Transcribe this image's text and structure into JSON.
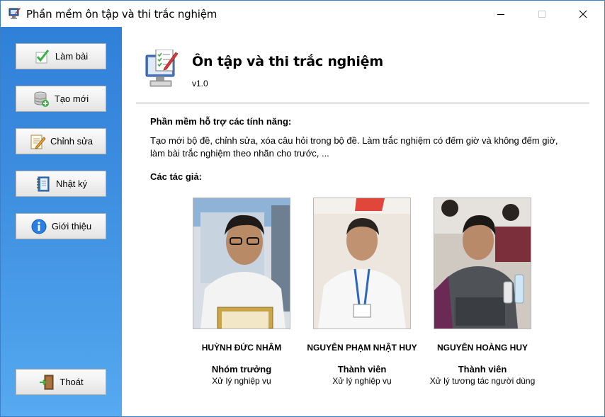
{
  "window": {
    "title": "Phần mềm ôn tập và thi trắc nghiệm"
  },
  "sidebar": {
    "items": [
      {
        "label": "Làm bài",
        "icon": "checkbox-icon"
      },
      {
        "label": "Tạo mới",
        "icon": "database-add-icon"
      },
      {
        "label": "Chỉnh sửa",
        "icon": "edit-document-icon"
      },
      {
        "label": "Nhật ký",
        "icon": "notebook-icon"
      },
      {
        "label": "Giới thiệu",
        "icon": "info-icon"
      }
    ],
    "exit": {
      "label": "Thoát",
      "icon": "exit-door-icon"
    }
  },
  "about": {
    "title": "Ôn tập và thi trắc nghiệm",
    "version": "v1.0",
    "features_heading": "Phần mềm hỗ trợ các tính năng:",
    "features_line1": "Tạo mới bộ đề, chỉnh sửa, xóa câu hỏi trong bộ đề. Làm trắc nghiệm có đếm giờ và không đếm giờ,",
    "features_line2": "làm bài trắc nghiệm theo nhãn cho trước, ...",
    "authors_heading": "Các tác giả:"
  },
  "authors": [
    {
      "name": "HUỲNH ĐỨC NHÂM",
      "role": "Nhóm trưởng",
      "task": "Xử lý nghiệp vụ"
    },
    {
      "name": "NGUYỄN PHẠM NHẬT HUY",
      "role": "Thành viên",
      "task": "Xử lý nghiệp vụ"
    },
    {
      "name": "NGUYỄN HOÀNG HUY",
      "role": "Thành viên",
      "task": "Xử lý tương tác người dùng"
    }
  ],
  "colors": {
    "sidebar_top": "#2f80d8",
    "sidebar_bottom": "#57aaf0",
    "window_border": "#3c7fc7"
  }
}
